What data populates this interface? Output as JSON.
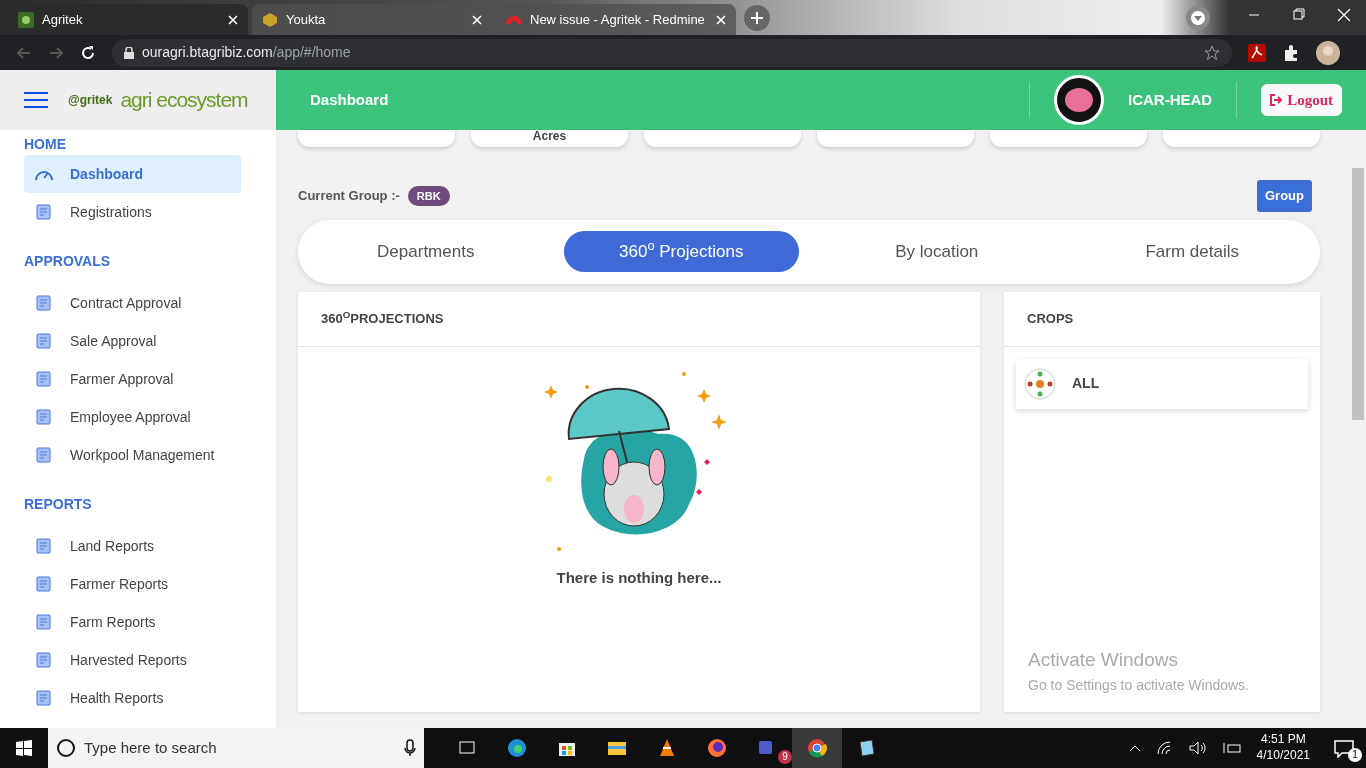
{
  "browser": {
    "tabs": [
      {
        "title": "Agritek",
        "selected": true
      },
      {
        "title": "Youkta",
        "selected": false
      },
      {
        "title": "New issue - Agritek - Redmine",
        "selected": false
      }
    ],
    "url": {
      "host": "ouragri.btagribiz.com",
      "path": "/app/#/home"
    }
  },
  "logo": {
    "mark": "@gritek",
    "name": "agri ecosystem"
  },
  "header": {
    "title": "Dashboard",
    "user": "ICAR-HEAD",
    "logout": "Logout"
  },
  "sidebar": [
    {
      "heading": "HOME",
      "items": [
        {
          "label": "Dashboard",
          "selected": true
        },
        {
          "label": "Registrations",
          "selected": false
        }
      ]
    },
    {
      "heading": "APPROVALS",
      "items": [
        {
          "label": "Contract Approval",
          "selected": false
        },
        {
          "label": "Sale Approval",
          "selected": false
        },
        {
          "label": "Farmer Approval",
          "selected": false
        },
        {
          "label": "Employee Approval",
          "selected": false
        },
        {
          "label": "Workpool Management",
          "selected": false
        }
      ]
    },
    {
      "heading": "REPORTS",
      "items": [
        {
          "label": "Land Reports",
          "selected": false
        },
        {
          "label": "Farmer Reports",
          "selected": false
        },
        {
          "label": "Farm Reports",
          "selected": false
        },
        {
          "label": "Harvested Reports",
          "selected": false
        },
        {
          "label": "Health Reports",
          "selected": false
        }
      ]
    }
  ],
  "stat_cards": [
    {
      "kind": "blank"
    },
    {
      "kind": "text",
      "text": "Acres"
    },
    {
      "kind": "blank"
    },
    {
      "kind": "blank"
    },
    {
      "kind": "blank"
    },
    {
      "kind": "blank"
    }
  ],
  "group": {
    "label": "Current Group :-",
    "badge": "RBK",
    "button": "Group"
  },
  "tabs": [
    {
      "label": "Departments",
      "selected": false
    },
    {
      "label": "360$^{o}$ Projections",
      "selected": true
    },
    {
      "label": "By location",
      "selected": false
    },
    {
      "label": "Farm details",
      "selected": false
    }
  ],
  "projections": {
    "title": "360$^{O}$PROJECTIONS",
    "empty": "There is nothing here..."
  },
  "crops": {
    "title": "CROPS",
    "items": [
      {
        "label": "ALL"
      }
    ]
  },
  "activation": {
    "title": "Activate Windows",
    "text": "Go to Settings to activate Windows."
  },
  "taskbar": {
    "search_placeholder": "Type here to search",
    "teams_badge": "9",
    "time": "4:51 PM",
    "date": "4/10/2021",
    "notifications": "1"
  }
}
